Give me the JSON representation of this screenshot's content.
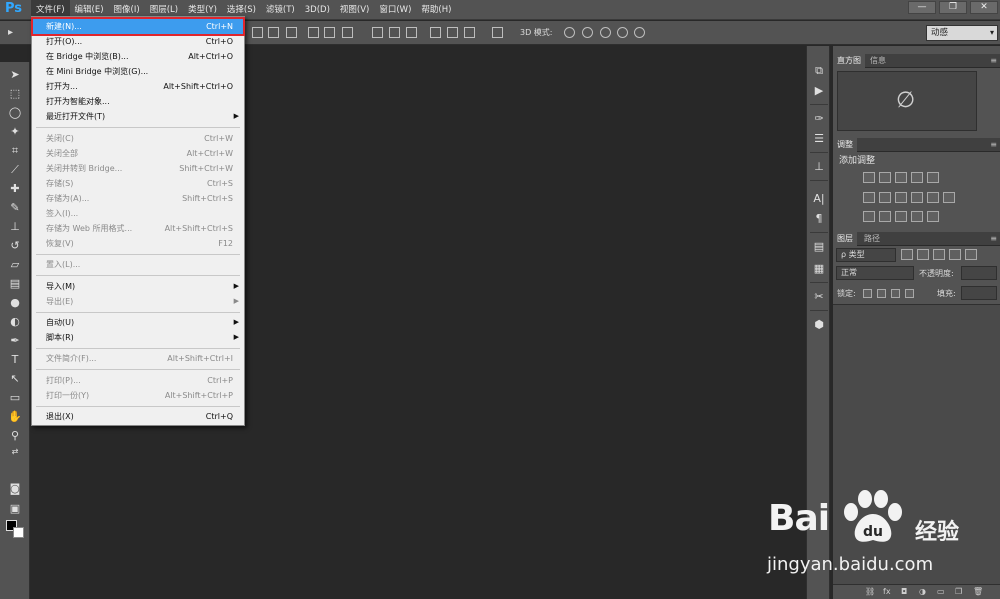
{
  "app": {
    "logo": "Ps"
  },
  "menubar": {
    "items": [
      "文件(F)",
      "编辑(E)",
      "图像(I)",
      "图层(L)",
      "类型(Y)",
      "选择(S)",
      "滤镜(T)",
      "3D(D)",
      "视图(V)",
      "窗口(W)",
      "帮助(H)"
    ]
  },
  "window_controls": {
    "minimize": "—",
    "restore": "❐",
    "close": "✕"
  },
  "options_bar": {
    "mode_label": "3D 模式:",
    "workspace": "动感"
  },
  "file_menu": {
    "items": [
      {
        "label": "新建(N)...",
        "shortcut": "Ctrl+N"
      },
      {
        "label": "打开(O)...",
        "shortcut": "Ctrl+O"
      },
      {
        "label": "在 Bridge 中浏览(B)...",
        "shortcut": "Alt+Ctrl+O"
      },
      {
        "label": "在 Mini Bridge 中浏览(G)...",
        "shortcut": ""
      },
      {
        "label": "打开为...",
        "shortcut": "Alt+Shift+Ctrl+O"
      },
      {
        "label": "打开为智能对象...",
        "shortcut": ""
      },
      {
        "label": "最近打开文件(T)",
        "shortcut": ""
      },
      {
        "label": "关闭(C)",
        "shortcut": "Ctrl+W"
      },
      {
        "label": "关闭全部",
        "shortcut": "Alt+Ctrl+W"
      },
      {
        "label": "关闭并转到 Bridge...",
        "shortcut": "Shift+Ctrl+W"
      },
      {
        "label": "存储(S)",
        "shortcut": "Ctrl+S"
      },
      {
        "label": "存储为(A)...",
        "shortcut": "Shift+Ctrl+S"
      },
      {
        "label": "签入(I)...",
        "shortcut": ""
      },
      {
        "label": "存储为 Web 所用格式...",
        "shortcut": "Alt+Shift+Ctrl+S"
      },
      {
        "label": "恢复(V)",
        "shortcut": "F12"
      },
      {
        "label": "置入(L)...",
        "shortcut": ""
      },
      {
        "label": "导入(M)",
        "shortcut": ""
      },
      {
        "label": "导出(E)",
        "shortcut": ""
      },
      {
        "label": "自动(U)",
        "shortcut": ""
      },
      {
        "label": "脚本(R)",
        "shortcut": ""
      },
      {
        "label": "文件简介(F)...",
        "shortcut": "Alt+Shift+Ctrl+I"
      },
      {
        "label": "打印(P)...",
        "shortcut": "Ctrl+P"
      },
      {
        "label": "打印一份(Y)",
        "shortcut": "Alt+Shift+Ctrl+P"
      },
      {
        "label": "退出(X)",
        "shortcut": "Ctrl+Q"
      }
    ]
  },
  "panels": {
    "top_tabs": [
      "直方图",
      "信息"
    ],
    "adjust_tab": "调整",
    "adjust_title": "添加调整",
    "layer_tabs": [
      "图层",
      "路径"
    ],
    "kind_filter": "ρ 类型",
    "blend_mode": "正常",
    "opacity_label": "不透明度:",
    "lock_label": "锁定:",
    "fill_label": "填充:"
  },
  "watermark": {
    "brand": "Bai",
    "brand2": "经验",
    "url": "jingyan.baidu.com"
  }
}
